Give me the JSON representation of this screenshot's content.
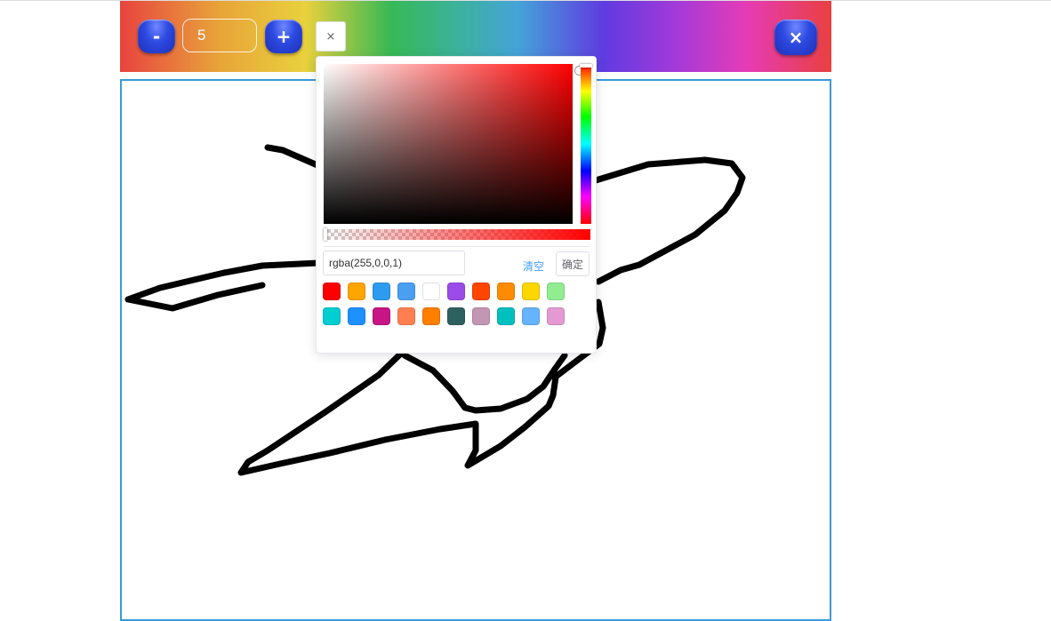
{
  "toolbar": {
    "minus_label": "-",
    "size_value": "5",
    "plus_label": "+",
    "close_label": "×",
    "color_trigger_label": "×"
  },
  "picker": {
    "value": "rgba(255,0,0,1)",
    "clear_label": "清空",
    "confirm_label": "确定",
    "current_color": "#ff0000",
    "swatches_row1": [
      "#ff0000",
      "#ffa500",
      "#2d9cf0",
      "#4a9ff0",
      "#ffffff",
      "#9b4be8",
      "#ff4500",
      "#ff8c00",
      "#ffd700",
      "#90ee90"
    ],
    "swatches_row2": [
      "#00ced1",
      "#1e90ff",
      "#c71585",
      "#ff7f50",
      "#ff7f00",
      "#2f6060",
      "#c396b4",
      "#00bfbf",
      "#66b3ff",
      "#e49ad1"
    ]
  },
  "canvas": {
    "stroke_color": "#000000"
  }
}
